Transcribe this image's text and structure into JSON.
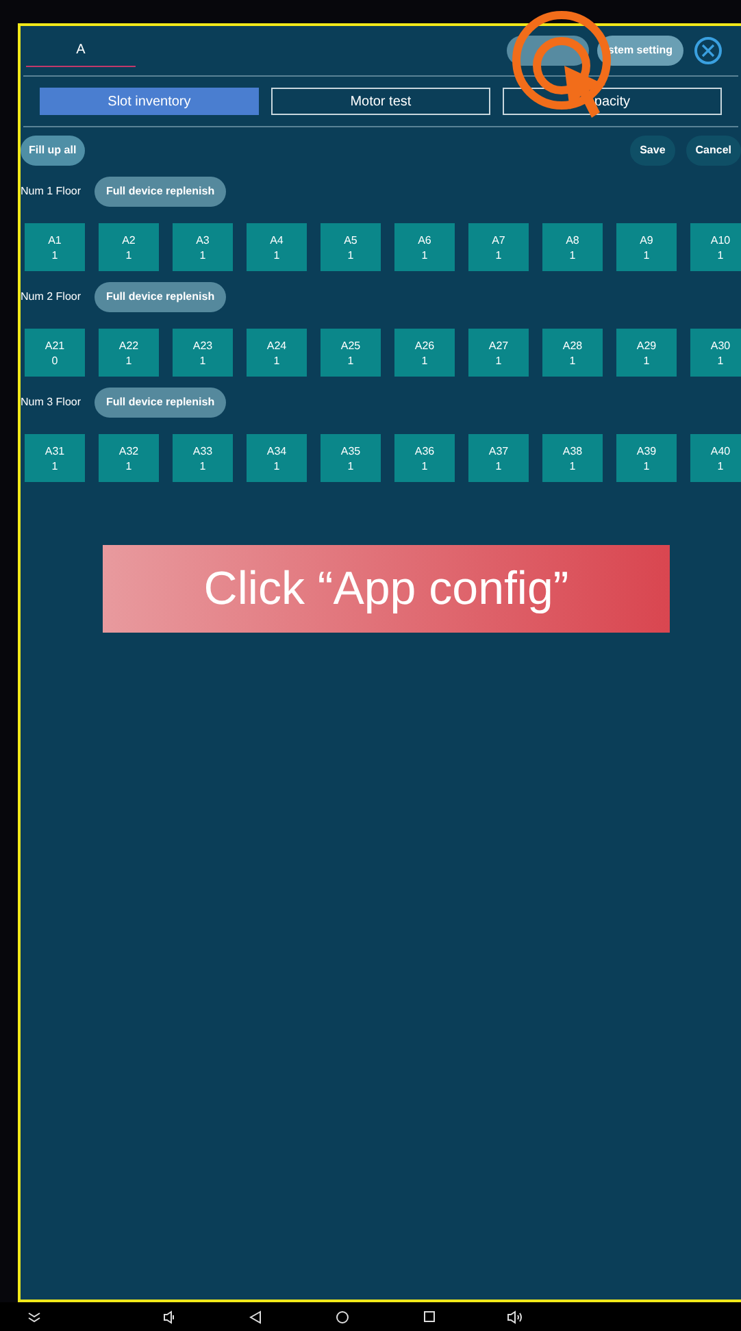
{
  "header": {
    "tab": "A",
    "buttons": [
      {
        "covered": true
      },
      {
        "covered": false,
        "label": "stem setting"
      }
    ]
  },
  "tabs": [
    {
      "label": "Slot inventory",
      "selected": true
    },
    {
      "label": "Motor test",
      "selected": false
    },
    {
      "label": "pacity",
      "selected": false
    }
  ],
  "actions": {
    "left": "Fill up all",
    "right": [
      "Save",
      "Cancel"
    ]
  },
  "floors": [
    {
      "label": "Num 1 Floor",
      "button": "Full device replenish",
      "slots": [
        [
          "A1",
          "1"
        ],
        [
          "A2",
          "1"
        ],
        [
          "A3",
          "1"
        ],
        [
          "A4",
          "1"
        ],
        [
          "A5",
          "1"
        ],
        [
          "A6",
          "1"
        ],
        [
          "A7",
          "1"
        ],
        [
          "A8",
          "1"
        ],
        [
          "A9",
          "1"
        ],
        [
          "A10",
          "1"
        ]
      ]
    },
    {
      "label": "Num 2 Floor",
      "button": "Full device replenish",
      "slots": [
        [
          "A21",
          "0"
        ],
        [
          "A22",
          "1"
        ],
        [
          "A23",
          "1"
        ],
        [
          "A24",
          "1"
        ],
        [
          "A25",
          "1"
        ],
        [
          "A26",
          "1"
        ],
        [
          "A27",
          "1"
        ],
        [
          "A28",
          "1"
        ],
        [
          "A29",
          "1"
        ],
        [
          "A30",
          "1"
        ]
      ]
    },
    {
      "label": "Num 3 Floor",
      "button": "Full device replenish",
      "slots": [
        [
          "A31",
          "1"
        ],
        [
          "A32",
          "1"
        ],
        [
          "A33",
          "1"
        ],
        [
          "A34",
          "1"
        ],
        [
          "A35",
          "1"
        ],
        [
          "A36",
          "1"
        ],
        [
          "A37",
          "1"
        ],
        [
          "A38",
          "1"
        ],
        [
          "A39",
          "1"
        ],
        [
          "A40",
          "1"
        ]
      ]
    }
  ],
  "callout": "Click “App config”"
}
